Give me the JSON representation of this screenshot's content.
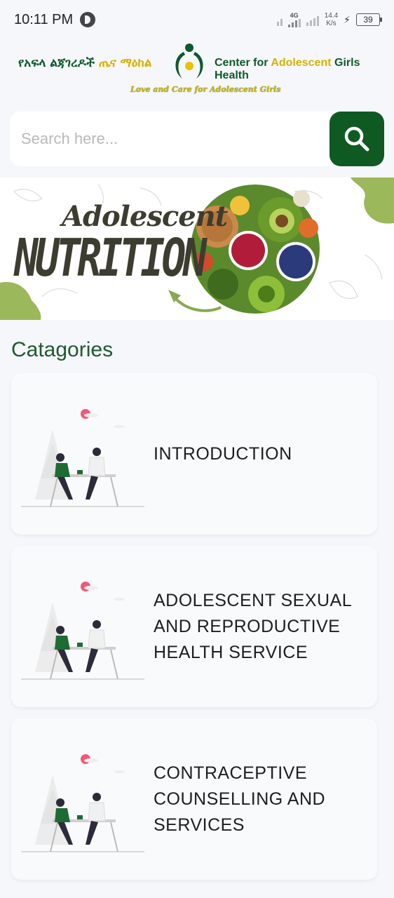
{
  "status_bar": {
    "time": "10:11 PM",
    "network_type": "4G",
    "net_speed_value": "14.4",
    "net_speed_unit": "K/s",
    "battery": "39"
  },
  "header": {
    "amharic_name_part1": "የአፍላ ልጃገረዶች ",
    "amharic_name_part2": "ጤና ",
    "amharic_name_part3": "ማዕከል",
    "english_name_part1": "Center for ",
    "english_name_part2": "Adolescent ",
    "english_name_part3": "Girls Health",
    "tagline": "Love and Care for Adolescent Girls"
  },
  "search": {
    "placeholder": "Search here..."
  },
  "banner": {
    "title_small": "Adolescent",
    "title_big": "NUTRITION"
  },
  "categories": {
    "title": "Catagories",
    "items": [
      {
        "label": "INTRODUCTION"
      },
      {
        "label": "ADOLESCENT SEXUAL AND REPRODUCTIVE HEALTH SERVICE"
      },
      {
        "label": "CONTRACEPTIVE COUNSELLING AND SERVICES"
      }
    ]
  },
  "colors": {
    "brand_green": "#0f5a22",
    "brand_yellow": "#d4b300",
    "background": "#f6f7fb"
  }
}
